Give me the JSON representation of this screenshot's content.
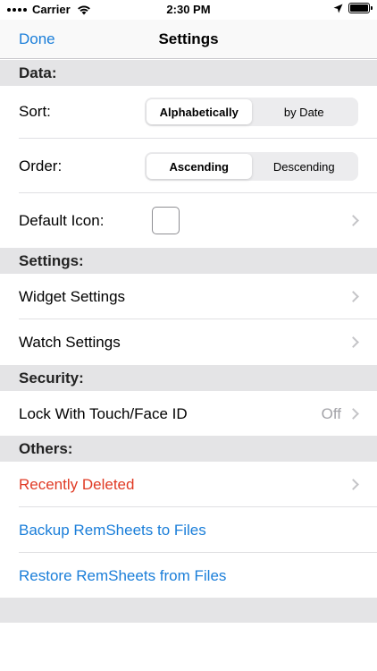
{
  "status_bar": {
    "carrier": "Carrier",
    "time": "2:30 PM",
    "icons": [
      "signal-dots-icon",
      "wifi-icon",
      "location-arrow-icon",
      "battery-icon"
    ]
  },
  "nav": {
    "done_label": "Done",
    "title": "Settings"
  },
  "sections": {
    "data": {
      "header": "Data:",
      "sort_label": "Sort:",
      "sort_options": [
        "Alphabetically",
        "by Date"
      ],
      "sort_selected": "Alphabetically",
      "order_label": "Order:",
      "order_options": [
        "Ascending",
        "Descending"
      ],
      "order_selected": "Ascending",
      "default_icon_label": "Default Icon:"
    },
    "settings": {
      "header": "Settings:",
      "widget_settings": "Widget Settings",
      "watch_settings": "Watch Settings"
    },
    "security": {
      "header": "Security:",
      "lock_label": "Lock With Touch/Face ID",
      "lock_value": "Off"
    },
    "others": {
      "header": "Others:",
      "recently_deleted": "Recently Deleted",
      "backup": "Backup RemSheets to Files",
      "restore": "Restore RemSheets from Files"
    }
  },
  "colors": {
    "accent_blue": "#1a7ed9",
    "destructive_red": "#e03a24",
    "section_gray": "#e4e4e6",
    "secondary_text": "#a3a3a8"
  }
}
